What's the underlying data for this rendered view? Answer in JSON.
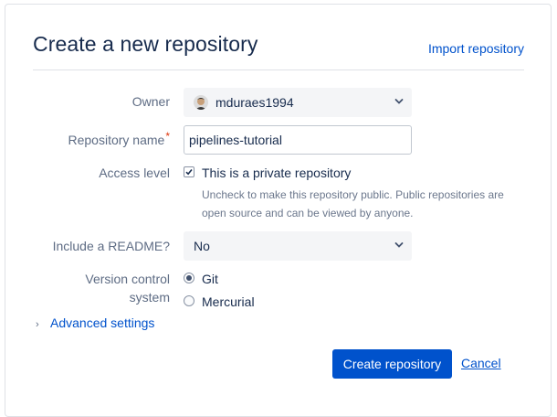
{
  "page": {
    "title": "Create a new repository",
    "import_link": "Import repository"
  },
  "form": {
    "owner": {
      "label": "Owner",
      "value": "mduraes1994"
    },
    "repository_name": {
      "label": "Repository name",
      "required_marker": "*",
      "value": "pipelines-tutorial"
    },
    "access_level": {
      "label": "Access level",
      "checked": true,
      "option_label": "This is a private repository",
      "help_line1": "Uncheck to make this repository public. Public repositories are",
      "help_line2": "open source and can be viewed by anyone."
    },
    "readme": {
      "label": "Include a README?",
      "value": "No"
    },
    "version_control": {
      "label_line1": "Version control",
      "label_line2": "system",
      "options": [
        {
          "label": "Git",
          "selected": true
        },
        {
          "label": "Mercurial",
          "selected": false
        }
      ]
    },
    "advanced_settings": "Advanced settings"
  },
  "actions": {
    "create_label": "Create repository",
    "cancel_label": "Cancel"
  },
  "colors": {
    "primary": "#0052cc",
    "text": "#172b4d",
    "label": "#5e6c84",
    "required": "#de350b"
  }
}
